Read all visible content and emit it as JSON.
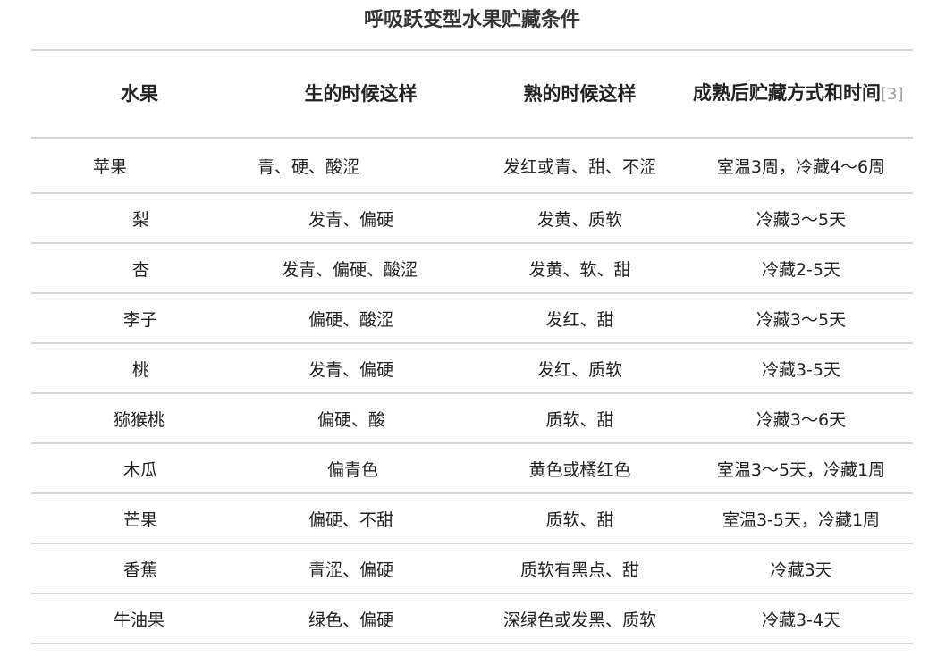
{
  "title": "呼吸跃变型水果贮藏条件",
  "table": {
    "headers": {
      "fruit": "水果",
      "raw": "生的时候这样",
      "ripe": "熟的时候这样",
      "storage": "成熟后贮藏方式和时间",
      "storage_ref": "[3]"
    },
    "rows": [
      {
        "fruit": "苹果",
        "raw": "青、硬、酸涩",
        "ripe": "发红或青、甜、不涩",
        "storage": "室温3周，冷藏4～6周"
      },
      {
        "fruit": "梨",
        "raw": "发青、偏硬",
        "ripe": "发黄、质软",
        "storage": "冷藏3～5天"
      },
      {
        "fruit": "杏",
        "raw": "发青、偏硬、酸涩",
        "ripe": "发黄、软、甜",
        "storage": "冷藏2-5天"
      },
      {
        "fruit": "李子",
        "raw": "偏硬、酸涩",
        "ripe": "发红、甜",
        "storage": "冷藏3～5天"
      },
      {
        "fruit": "桃",
        "raw": "发青、偏硬",
        "ripe": "发红、质软",
        "storage": "冷藏3-5天"
      },
      {
        "fruit": "猕猴桃",
        "raw": "偏硬、酸",
        "ripe": "质软、甜",
        "storage": "冷藏3～6天"
      },
      {
        "fruit": "木瓜",
        "raw": "偏青色",
        "ripe": "黄色或橘红色",
        "storage": "室温3～5天，冷藏1周"
      },
      {
        "fruit": "芒果",
        "raw": "偏硬、不甜",
        "ripe": "质软、甜",
        "storage": "室温3-5天，冷藏1周"
      },
      {
        "fruit": "香蕉",
        "raw": "青涩、偏硬",
        "ripe": "质软有黑点、甜",
        "storage": "冷藏3天"
      },
      {
        "fruit": "牛油果",
        "raw": "绿色、偏硬",
        "ripe": "深绿色或发黑、质软",
        "storage": "冷藏3-4天"
      }
    ]
  }
}
